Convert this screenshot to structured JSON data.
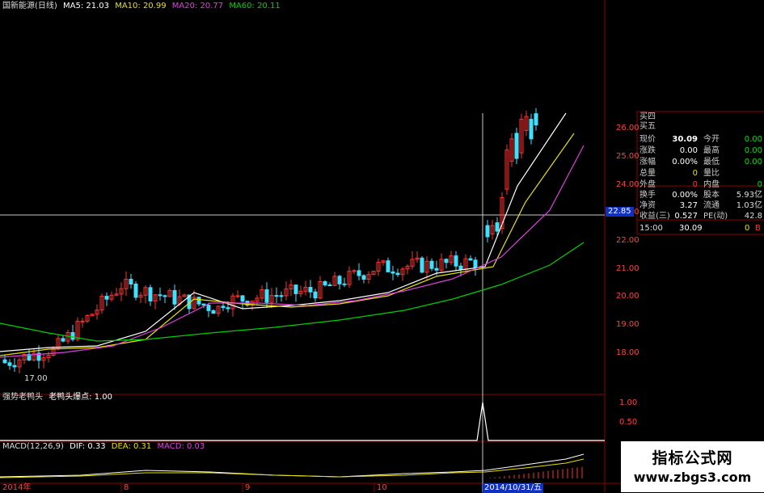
{
  "header": {
    "stock_name": "国新能源(日线)",
    "ma_labels": [
      {
        "text": "MA5: 21.03",
        "color": "#ffffff"
      },
      {
        "text": "MA10: 20.99",
        "color": "#e8e000"
      },
      {
        "text": "MA20: 20.77",
        "color": "#e040e0"
      },
      {
        "text": "MA60: 20.11",
        "color": "#00d000"
      }
    ]
  },
  "price_axis": {
    "ticks": [
      "26.00",
      "25.00",
      "24.00",
      "23.00",
      "22.00",
      "21.00",
      "20.00",
      "19.00",
      "18.00"
    ],
    "crosshair_price": "22.85"
  },
  "low_marker": "17.00",
  "indicator": {
    "title": "强势老鸭头",
    "value_label": "老鸭头爆点: 1.00",
    "ticks": [
      "1.00",
      "0.50"
    ]
  },
  "macd": {
    "title": "MACD(12,26,9)",
    "dif": "DIF: 0.33",
    "dea": "DEA: 0.31",
    "macd": "MACD: 0.03"
  },
  "date_axis": {
    "labels": [
      "2014年",
      "8",
      "9",
      "10"
    ],
    "cursor_date": "2014/10/31/五"
  },
  "quote": {
    "bids": [
      "买四",
      "买五"
    ],
    "rows": [
      {
        "l1": "现价",
        "v1": "30.09",
        "l2": "今开",
        "v2": "0.00",
        "c2": "#00e000"
      },
      {
        "l1": "涨跌",
        "v1": "0.00",
        "l2": "最高",
        "v2": "0.00",
        "c2": "#00e000"
      },
      {
        "l1": "涨幅",
        "v1": "0.00%",
        "l2": "最低",
        "v2": "0.00",
        "c2": "#00e000"
      },
      {
        "l1": "总量",
        "v1": "0",
        "l2": "量比",
        "v2": "",
        "c2": "#ffffff"
      },
      {
        "l1": "外盘",
        "v1": "0",
        "l2": "内盘",
        "v2": "0",
        "c2": "#00e000"
      },
      {
        "l1": "换手",
        "v1": "0.00%",
        "l2": "股本",
        "v2": "5.93亿",
        "c2": "#ffffff"
      },
      {
        "l1": "净资",
        "v1": "3.27",
        "l2": "流通",
        "v2": "1.03亿",
        "c2": "#ffffff"
      },
      {
        "l1": "收益(三)",
        "v1": "0.527",
        "l2": "PE(动)",
        "v2": "42.8",
        "c2": "#ffffff"
      }
    ],
    "tick": {
      "time": "15:00",
      "price": "30.09",
      "vol": "0",
      "flag": "B"
    }
  },
  "watermark": {
    "title": "指标公式网",
    "url": "www.zbgs3.com"
  },
  "colors": {
    "up": "#ff3030",
    "down": "#40e0ff",
    "ma5": "#ffffff",
    "ma10": "#e8e000",
    "ma20": "#e040e0",
    "ma60": "#00d000",
    "grid": "#8b0000",
    "axis_text": "#ff4040"
  }
}
